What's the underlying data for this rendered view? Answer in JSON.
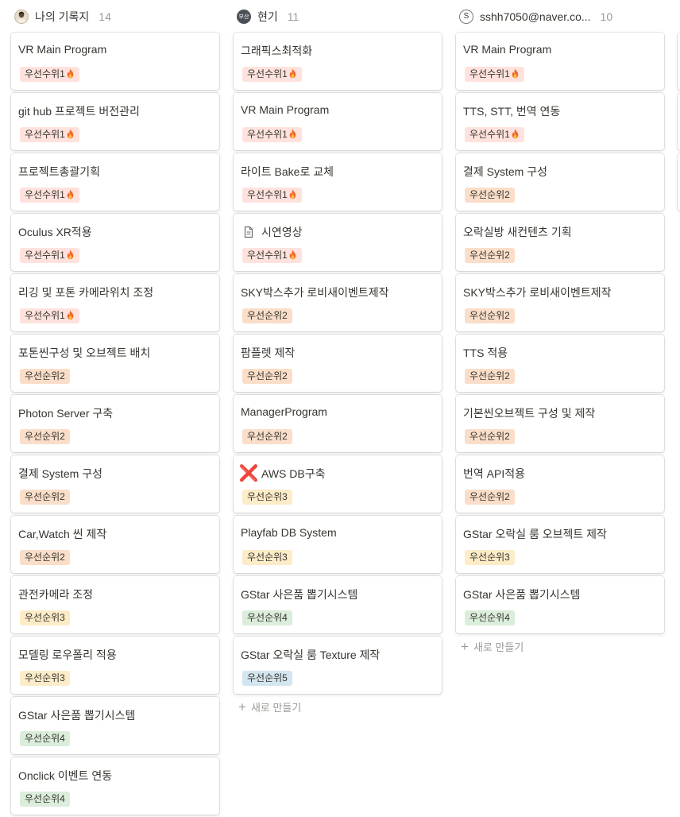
{
  "columns": [
    {
      "name": "나의 기록지",
      "count": "14",
      "avatar": {
        "type": "photo",
        "icon": "user-avatar-icon"
      },
      "new_label": "",
      "cards": [
        {
          "title": "VR Main Program",
          "tag": "우선수위1",
          "level": 1
        },
        {
          "title": "git hub 프로젝트 버전관리",
          "tag": "우선수위1",
          "level": 1
        },
        {
          "title": "프로젝트총괄기획",
          "tag": "우선수위1",
          "level": 1
        },
        {
          "title": "Oculus XR적용",
          "tag": "우선수위1",
          "level": 1
        },
        {
          "title": "리깅 및 포톤 카메라위치 조정",
          "tag": "우선수위1",
          "level": 1
        },
        {
          "title": "포톤씬구성 및 오브젝트 배치",
          "tag": "우선순위2",
          "level": 2
        },
        {
          "title": "Photon Server 구축",
          "tag": "우선순위2",
          "level": 2
        },
        {
          "title": "결제 System 구성",
          "tag": "우선순위2",
          "level": 2
        },
        {
          "title": "Car,Watch 씬 제작",
          "tag": "우선순위2",
          "level": 2
        },
        {
          "title": "관전카메라 조정",
          "tag": "우선순위3",
          "level": 3
        },
        {
          "title": "모델링 로우폴리 적용",
          "tag": "우선순위3",
          "level": 3
        },
        {
          "title": "GStar 사은품 뽑기시스템",
          "tag": "우선순위4",
          "level": 4
        },
        {
          "title": "Onclick 이벤트 연동",
          "tag": "우선순위4",
          "level": 4
        }
      ]
    },
    {
      "name": "현기",
      "count": "11",
      "avatar": {
        "type": "initial",
        "text": "부산"
      },
      "new_label": "새로 만들기",
      "cards": [
        {
          "title": "그래픽스최적화",
          "tag": "우선수위1",
          "level": 1
        },
        {
          "title": "VR Main Program",
          "tag": "우선수위1",
          "level": 1
        },
        {
          "title": "라이트 Bake로 교체",
          "tag": "우선수위1",
          "level": 1
        },
        {
          "title": "시연영상",
          "tag": "우선수위1",
          "level": 1,
          "icon": "document-icon"
        },
        {
          "title": "SKY박스추가 로비새이벤트제작",
          "tag": "우선순위2",
          "level": 2
        },
        {
          "title": "팜플렛 제작",
          "tag": "우선순위2",
          "level": 2
        },
        {
          "title": "ManagerProgram",
          "tag": "우선순위2",
          "level": 2
        },
        {
          "title": "AWS DB구축",
          "tag": "우선순위3",
          "level": 3,
          "icon": "cross-mark-icon"
        },
        {
          "title": "Playfab DB System",
          "tag": "우선순위3",
          "level": 3
        },
        {
          "title": "GStar 사은품 뽑기시스템",
          "tag": "우선순위4",
          "level": 4
        },
        {
          "title": "GStar 오락실 룸 Texture 제작",
          "tag": "우선순위5",
          "level": 5
        }
      ]
    },
    {
      "name": "sshh7050@naver.co...",
      "count": "10",
      "avatar": {
        "type": "letter",
        "text": "S"
      },
      "new_label": "새로 만들기",
      "cards": [
        {
          "title": "VR Main Program",
          "tag": "우선수위1",
          "level": 1
        },
        {
          "title": "TTS, STT, 번역 연동",
          "tag": "우선수위1",
          "level": 1
        },
        {
          "title": "결제 System 구성",
          "tag": "우선순위2",
          "level": 2
        },
        {
          "title": "오락실방 새컨텐츠 기획",
          "tag": "우선순위2",
          "level": 2
        },
        {
          "title": "SKY박스추가 로비새이벤트제작",
          "tag": "우선순위2",
          "level": 2
        },
        {
          "title": "TTS 적용",
          "tag": "우선순위2",
          "level": 2
        },
        {
          "title": "기본씬오브젝트 구성 및 제작",
          "tag": "우선순위2",
          "level": 2
        },
        {
          "title": "번역 API적용",
          "tag": "우선순위2",
          "level": 2
        },
        {
          "title": "GStar 오락실 룸 오브젝트 제작",
          "tag": "우선순위3",
          "level": 3
        },
        {
          "title": "GStar 사은품 뽑기시스템",
          "tag": "우선순위4",
          "level": 4
        }
      ]
    }
  ],
  "colors": {
    "priority1": "#ffe2dd",
    "priority2": "#fadec9",
    "priority3": "#fdecc8",
    "priority4": "#dbeddb",
    "priority5": "#d3e5ef"
  },
  "icons": {
    "fire": "fire-icon",
    "plus": "plus-icon"
  }
}
